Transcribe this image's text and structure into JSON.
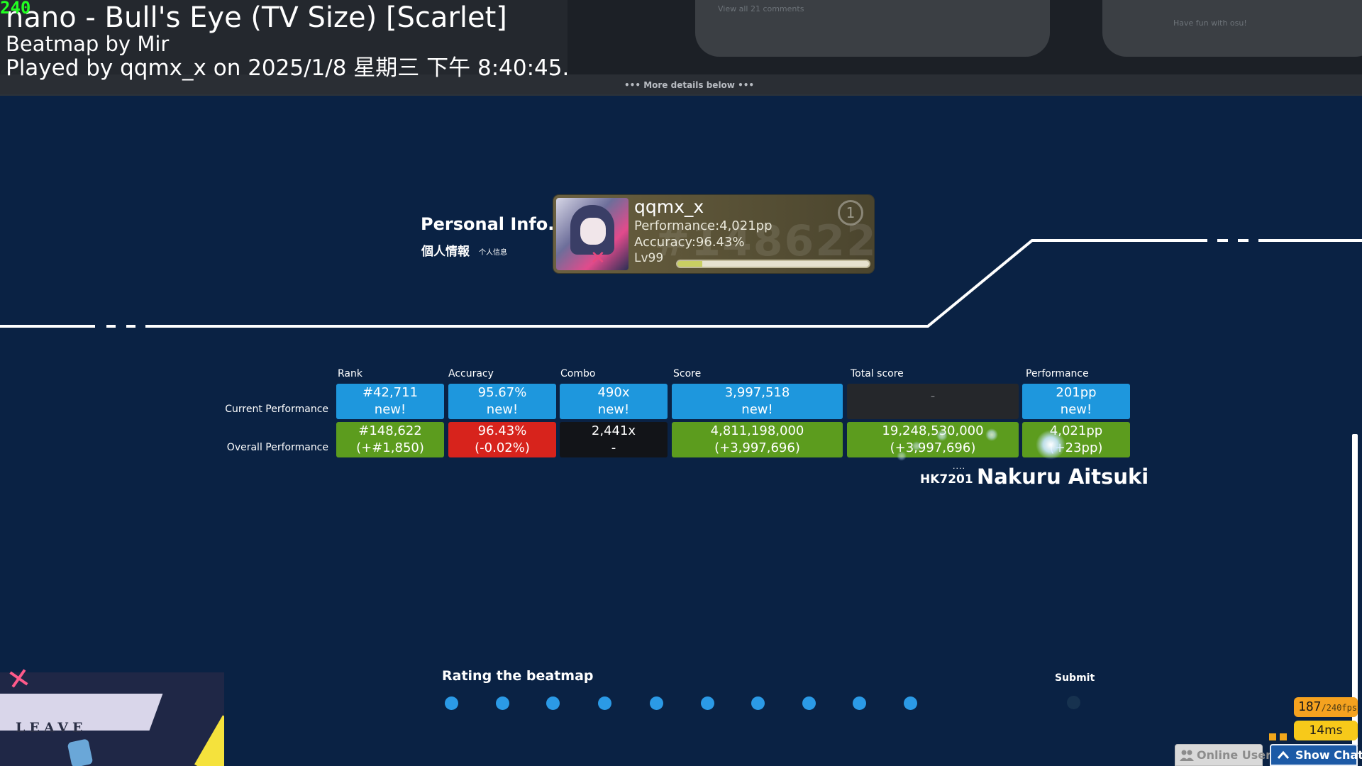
{
  "header": {
    "fps_counter": "240",
    "title": "nano - Bull's Eye (TV Size) [Scarlet]",
    "mapper": "Beatmap by Mir",
    "played": "Played by qqmx_x on 2025/1/8 星期三 下午 8:40:45.",
    "more_details": "••• More details below •••",
    "bg_comment_link": "View all 21 comments",
    "bg_card_text": "Have fun with osu!"
  },
  "personal_info": {
    "title": "Personal Info.",
    "subtitle": "個人情報",
    "subtitle_small": "个人信息"
  },
  "user_card": {
    "name": "qqmx_x",
    "performance": "Performance:4,021pp",
    "accuracy": "Accuracy:96.43%",
    "level": "Lv99",
    "level_progress": 0.13,
    "rank_bg": "#148622",
    "badge": "1"
  },
  "stats": {
    "columns": [
      "Rank",
      "Accuracy",
      "Combo",
      "Score",
      "Total score",
      "Performance"
    ],
    "rows": [
      {
        "label": "Current Performance",
        "cells": [
          {
            "line1": "#42,711",
            "line2": "new!"
          },
          {
            "line1": "95.67%",
            "line2": "new!"
          },
          {
            "line1": "490x",
            "line2": "new!"
          },
          {
            "line1": "3,997,518",
            "line2": "new!"
          },
          {
            "line1": "-",
            "line2": ""
          },
          {
            "line1": "201pp",
            "line2": "new!"
          }
        ]
      },
      {
        "label": "Overall Performance",
        "cells": [
          {
            "line1": "#148,622",
            "line2": "(+#1,850)"
          },
          {
            "line1": "96.43%",
            "line2": "(-0.02%)"
          },
          {
            "line1": "2,441x",
            "line2": "-"
          },
          {
            "line1": "4,811,198,000",
            "line2": "(+3,997,696)"
          },
          {
            "line1": "19,248,530,000",
            "line2": "(+3,997,696)"
          },
          {
            "line1": "4,021pp",
            "line2": "(+23pp)"
          }
        ]
      }
    ]
  },
  "mapper_credit": {
    "tag": "HK7201",
    "name": "Nakuru Aitsuki"
  },
  "rating": {
    "title": "Rating the beatmap",
    "count": 10,
    "submit_label": "Submit"
  },
  "thumbnail": {
    "text": "LEAVE"
  },
  "status": {
    "fps": "187",
    "fps_max": "/240fps",
    "latency": "14ms"
  },
  "buttons": {
    "online_users": "Online Users",
    "show_chat": "Show Chat"
  },
  "colors": {
    "background": "#0a2244",
    "cell_blue": "#1e97dd",
    "cell_green": "#5c9c1e",
    "cell_red": "#d7231c",
    "fps_orange": "#f5a21f",
    "ms_yellow": "#f7c91a",
    "chat_blue": "#1c5aa6"
  }
}
